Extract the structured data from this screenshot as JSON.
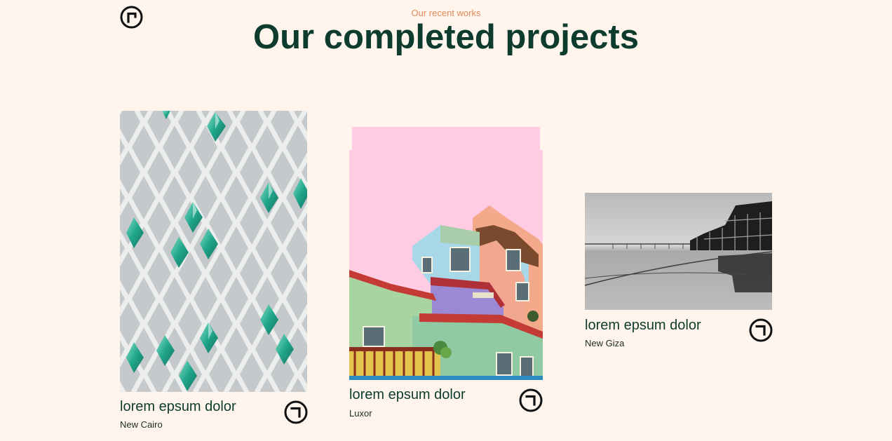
{
  "brand": {
    "logo_icon": "circle-corner-logo-icon"
  },
  "section": {
    "eyebrow": "Our recent works",
    "title": "Our completed projects"
  },
  "colors": {
    "background": "#fff5ec",
    "heading": "#0d3b2e",
    "eyebrow": "#e08a5a",
    "pink_backdrop": "#ffccE4"
  },
  "projects": [
    {
      "title": "lorem epsum dolor",
      "city": "New Cairo",
      "image": "diamond-lattice-facade-photo",
      "action_icon": "circle-arrow-icon"
    },
    {
      "title": "lorem epsum dolor",
      "city": "Luxor",
      "image": "colorful-houses-photo",
      "action_icon": "circle-arrow-icon"
    },
    {
      "title": "lorem epsum dolor",
      "city": "New Giza",
      "image": "monochrome-pier-photo",
      "action_icon": "circle-arrow-icon"
    }
  ]
}
